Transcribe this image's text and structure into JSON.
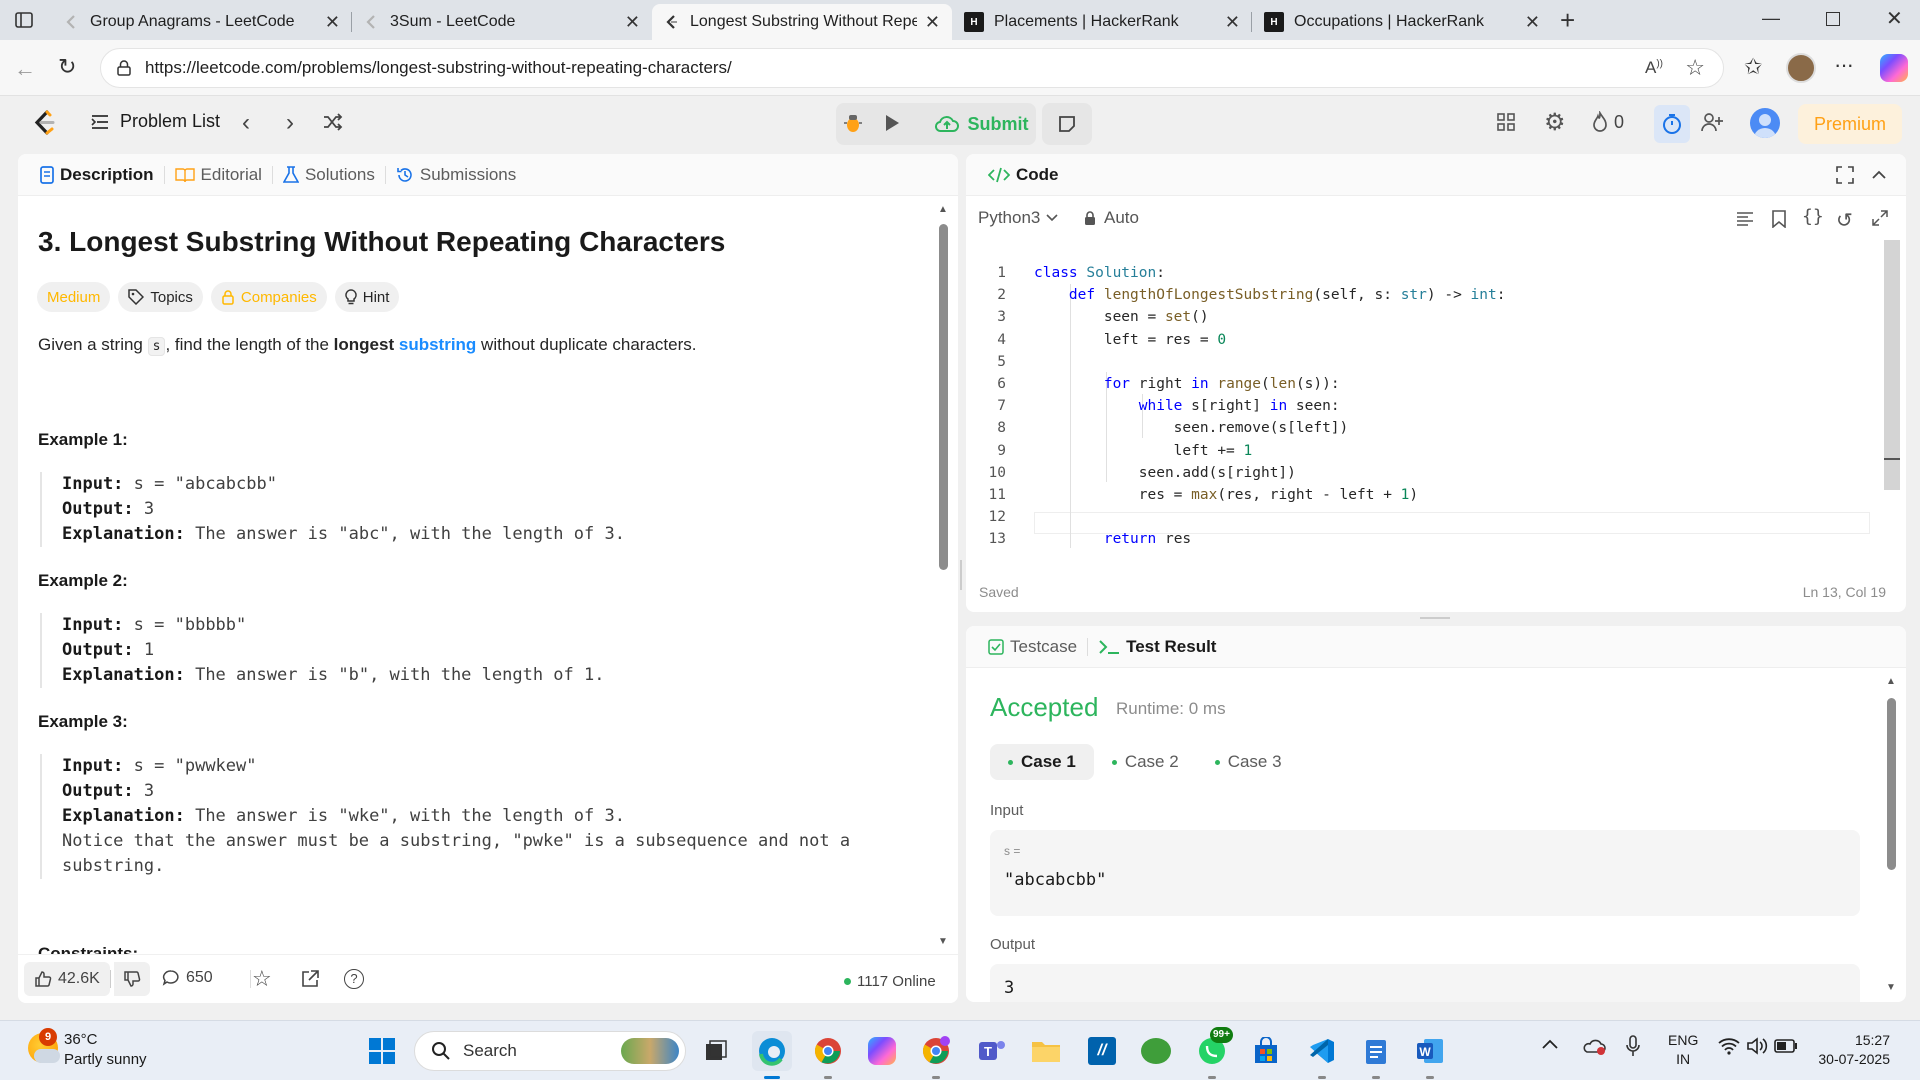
{
  "browser": {
    "tabs": [
      {
        "title": "Group Anagrams - LeetCode",
        "favicon": "leetcode-icon"
      },
      {
        "title": "3Sum - LeetCode",
        "favicon": "leetcode-icon"
      },
      {
        "title": "Longest Substring Without Repea",
        "favicon": "leetcode-icon",
        "active": true
      },
      {
        "title": "Placements | HackerRank",
        "favicon": "hackerrank-icon"
      },
      {
        "title": "Occupations | HackerRank",
        "favicon": "hackerrank-icon"
      }
    ],
    "hackerrank_badge": "H",
    "url": "https://leetcode.com/problems/longest-substring-without-repeating-characters/"
  },
  "header": {
    "problem_list": "Problem List",
    "submit": "Submit",
    "streak": "0",
    "premium": "Premium"
  },
  "left_tabs": [
    "Description",
    "Editorial",
    "Solutions",
    "Submissions"
  ],
  "problem": {
    "title": "3. Longest Substring Without Repeating Characters",
    "difficulty": "Medium",
    "topics": "Topics",
    "companies": "Companies",
    "hint": "Hint",
    "desc_pre": "Given a string ",
    "desc_var": "s",
    "desc_mid": ", find the length of the ",
    "desc_bold": "longest",
    "desc_link": "substring",
    "desc_post": " without duplicate characters.",
    "examples": [
      {
        "heading": "Example 1:",
        "input": "s = \"abcabcbb\"",
        "output": "3",
        "explanation": "The answer is \"abc\", with the length of 3."
      },
      {
        "heading": "Example 2:",
        "input": "s = \"bbbbb\"",
        "output": "1",
        "explanation": "The answer is \"b\", with the length of 1."
      },
      {
        "heading": "Example 3:",
        "input": "s = \"pwwkew\"",
        "output": "3",
        "explanation": "The answer is \"wke\", with the length of 3.",
        "note1": "Notice that the answer must be a substring, \"pwke\" is a subsequence and not a",
        "note2": "substring."
      }
    ],
    "labels": {
      "input": "Input:",
      "output": "Output:",
      "explanation": "Explanation:"
    },
    "constraints_partial": "Constraints:"
  },
  "left_footer": {
    "likes": "42.6K",
    "comments": "650",
    "online": "1117 Online"
  },
  "code": {
    "title": "Code",
    "language": "Python3",
    "mode": "Auto",
    "saved": "Saved",
    "cursor": "Ln 13, Col 19"
  },
  "code_lines": [
    "class Solution:",
    "    def lengthOfLongestSubstring(self, s: str) -> int:",
    "        seen = set()",
    "        left = res = 0",
    "",
    "        for right in range(len(s)):",
    "            while s[right] in seen:",
    "                seen.remove(s[left])",
    "                left += 1",
    "            seen.add(s[right])",
    "            res = max(res, right - left + 1)",
    "",
    "        return res"
  ],
  "result": {
    "tabs": [
      "Testcase",
      "Test Result"
    ],
    "status": "Accepted",
    "runtime": "Runtime: 0 ms",
    "cases": [
      "Case 1",
      "Case 2",
      "Case 3"
    ],
    "input_label": "Input",
    "var_label": "s =",
    "input_value": "\"abcabcbb\"",
    "output_label": "Output",
    "output_value": "3"
  },
  "taskbar": {
    "weather_temp": "36°C",
    "weather_desc": "Partly sunny",
    "weather_badge": "9",
    "search": "Search",
    "whatsapp_badge": "99+",
    "lang1": "ENG",
    "lang2": "IN",
    "time": "15:27",
    "date": "30-07-2025"
  },
  "colors": {
    "accepted": "#2db55d",
    "link": "#1a8cff",
    "medium": "#ffb800",
    "premium": "#ffa116"
  }
}
